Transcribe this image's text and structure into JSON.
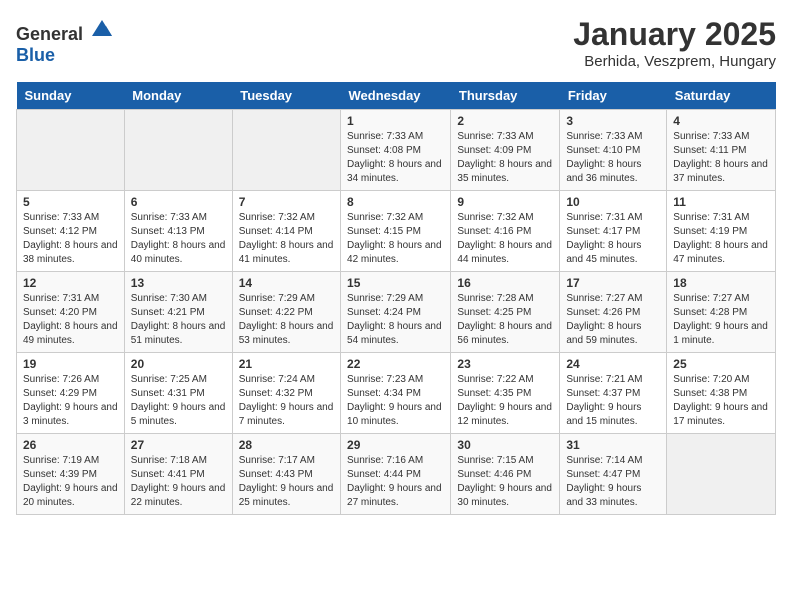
{
  "app": {
    "name_general": "General",
    "name_blue": "Blue"
  },
  "header": {
    "title": "January 2025",
    "subtitle": "Berhida, Veszprem, Hungary"
  },
  "weekdays": [
    "Sunday",
    "Monday",
    "Tuesday",
    "Wednesday",
    "Thursday",
    "Friday",
    "Saturday"
  ],
  "weeks": [
    [
      {
        "day": "",
        "empty": true
      },
      {
        "day": "",
        "empty": true
      },
      {
        "day": "",
        "empty": true
      },
      {
        "day": "1",
        "sunrise": "Sunrise: 7:33 AM",
        "sunset": "Sunset: 4:08 PM",
        "daylight": "Daylight: 8 hours and 34 minutes."
      },
      {
        "day": "2",
        "sunrise": "Sunrise: 7:33 AM",
        "sunset": "Sunset: 4:09 PM",
        "daylight": "Daylight: 8 hours and 35 minutes."
      },
      {
        "day": "3",
        "sunrise": "Sunrise: 7:33 AM",
        "sunset": "Sunset: 4:10 PM",
        "daylight": "Daylight: 8 hours and 36 minutes."
      },
      {
        "day": "4",
        "sunrise": "Sunrise: 7:33 AM",
        "sunset": "Sunset: 4:11 PM",
        "daylight": "Daylight: 8 hours and 37 minutes."
      }
    ],
    [
      {
        "day": "5",
        "sunrise": "Sunrise: 7:33 AM",
        "sunset": "Sunset: 4:12 PM",
        "daylight": "Daylight: 8 hours and 38 minutes."
      },
      {
        "day": "6",
        "sunrise": "Sunrise: 7:33 AM",
        "sunset": "Sunset: 4:13 PM",
        "daylight": "Daylight: 8 hours and 40 minutes."
      },
      {
        "day": "7",
        "sunrise": "Sunrise: 7:32 AM",
        "sunset": "Sunset: 4:14 PM",
        "daylight": "Daylight: 8 hours and 41 minutes."
      },
      {
        "day": "8",
        "sunrise": "Sunrise: 7:32 AM",
        "sunset": "Sunset: 4:15 PM",
        "daylight": "Daylight: 8 hours and 42 minutes."
      },
      {
        "day": "9",
        "sunrise": "Sunrise: 7:32 AM",
        "sunset": "Sunset: 4:16 PM",
        "daylight": "Daylight: 8 hours and 44 minutes."
      },
      {
        "day": "10",
        "sunrise": "Sunrise: 7:31 AM",
        "sunset": "Sunset: 4:17 PM",
        "daylight": "Daylight: 8 hours and 45 minutes."
      },
      {
        "day": "11",
        "sunrise": "Sunrise: 7:31 AM",
        "sunset": "Sunset: 4:19 PM",
        "daylight": "Daylight: 8 hours and 47 minutes."
      }
    ],
    [
      {
        "day": "12",
        "sunrise": "Sunrise: 7:31 AM",
        "sunset": "Sunset: 4:20 PM",
        "daylight": "Daylight: 8 hours and 49 minutes."
      },
      {
        "day": "13",
        "sunrise": "Sunrise: 7:30 AM",
        "sunset": "Sunset: 4:21 PM",
        "daylight": "Daylight: 8 hours and 51 minutes."
      },
      {
        "day": "14",
        "sunrise": "Sunrise: 7:29 AM",
        "sunset": "Sunset: 4:22 PM",
        "daylight": "Daylight: 8 hours and 53 minutes."
      },
      {
        "day": "15",
        "sunrise": "Sunrise: 7:29 AM",
        "sunset": "Sunset: 4:24 PM",
        "daylight": "Daylight: 8 hours and 54 minutes."
      },
      {
        "day": "16",
        "sunrise": "Sunrise: 7:28 AM",
        "sunset": "Sunset: 4:25 PM",
        "daylight": "Daylight: 8 hours and 56 minutes."
      },
      {
        "day": "17",
        "sunrise": "Sunrise: 7:27 AM",
        "sunset": "Sunset: 4:26 PM",
        "daylight": "Daylight: 8 hours and 59 minutes."
      },
      {
        "day": "18",
        "sunrise": "Sunrise: 7:27 AM",
        "sunset": "Sunset: 4:28 PM",
        "daylight": "Daylight: 9 hours and 1 minute."
      }
    ],
    [
      {
        "day": "19",
        "sunrise": "Sunrise: 7:26 AM",
        "sunset": "Sunset: 4:29 PM",
        "daylight": "Daylight: 9 hours and 3 minutes."
      },
      {
        "day": "20",
        "sunrise": "Sunrise: 7:25 AM",
        "sunset": "Sunset: 4:31 PM",
        "daylight": "Daylight: 9 hours and 5 minutes."
      },
      {
        "day": "21",
        "sunrise": "Sunrise: 7:24 AM",
        "sunset": "Sunset: 4:32 PM",
        "daylight": "Daylight: 9 hours and 7 minutes."
      },
      {
        "day": "22",
        "sunrise": "Sunrise: 7:23 AM",
        "sunset": "Sunset: 4:34 PM",
        "daylight": "Daylight: 9 hours and 10 minutes."
      },
      {
        "day": "23",
        "sunrise": "Sunrise: 7:22 AM",
        "sunset": "Sunset: 4:35 PM",
        "daylight": "Daylight: 9 hours and 12 minutes."
      },
      {
        "day": "24",
        "sunrise": "Sunrise: 7:21 AM",
        "sunset": "Sunset: 4:37 PM",
        "daylight": "Daylight: 9 hours and 15 minutes."
      },
      {
        "day": "25",
        "sunrise": "Sunrise: 7:20 AM",
        "sunset": "Sunset: 4:38 PM",
        "daylight": "Daylight: 9 hours and 17 minutes."
      }
    ],
    [
      {
        "day": "26",
        "sunrise": "Sunrise: 7:19 AM",
        "sunset": "Sunset: 4:39 PM",
        "daylight": "Daylight: 9 hours and 20 minutes."
      },
      {
        "day": "27",
        "sunrise": "Sunrise: 7:18 AM",
        "sunset": "Sunset: 4:41 PM",
        "daylight": "Daylight: 9 hours and 22 minutes."
      },
      {
        "day": "28",
        "sunrise": "Sunrise: 7:17 AM",
        "sunset": "Sunset: 4:43 PM",
        "daylight": "Daylight: 9 hours and 25 minutes."
      },
      {
        "day": "29",
        "sunrise": "Sunrise: 7:16 AM",
        "sunset": "Sunset: 4:44 PM",
        "daylight": "Daylight: 9 hours and 27 minutes."
      },
      {
        "day": "30",
        "sunrise": "Sunrise: 7:15 AM",
        "sunset": "Sunset: 4:46 PM",
        "daylight": "Daylight: 9 hours and 30 minutes."
      },
      {
        "day": "31",
        "sunrise": "Sunrise: 7:14 AM",
        "sunset": "Sunset: 4:47 PM",
        "daylight": "Daylight: 9 hours and 33 minutes."
      },
      {
        "day": "",
        "empty": true
      }
    ]
  ]
}
